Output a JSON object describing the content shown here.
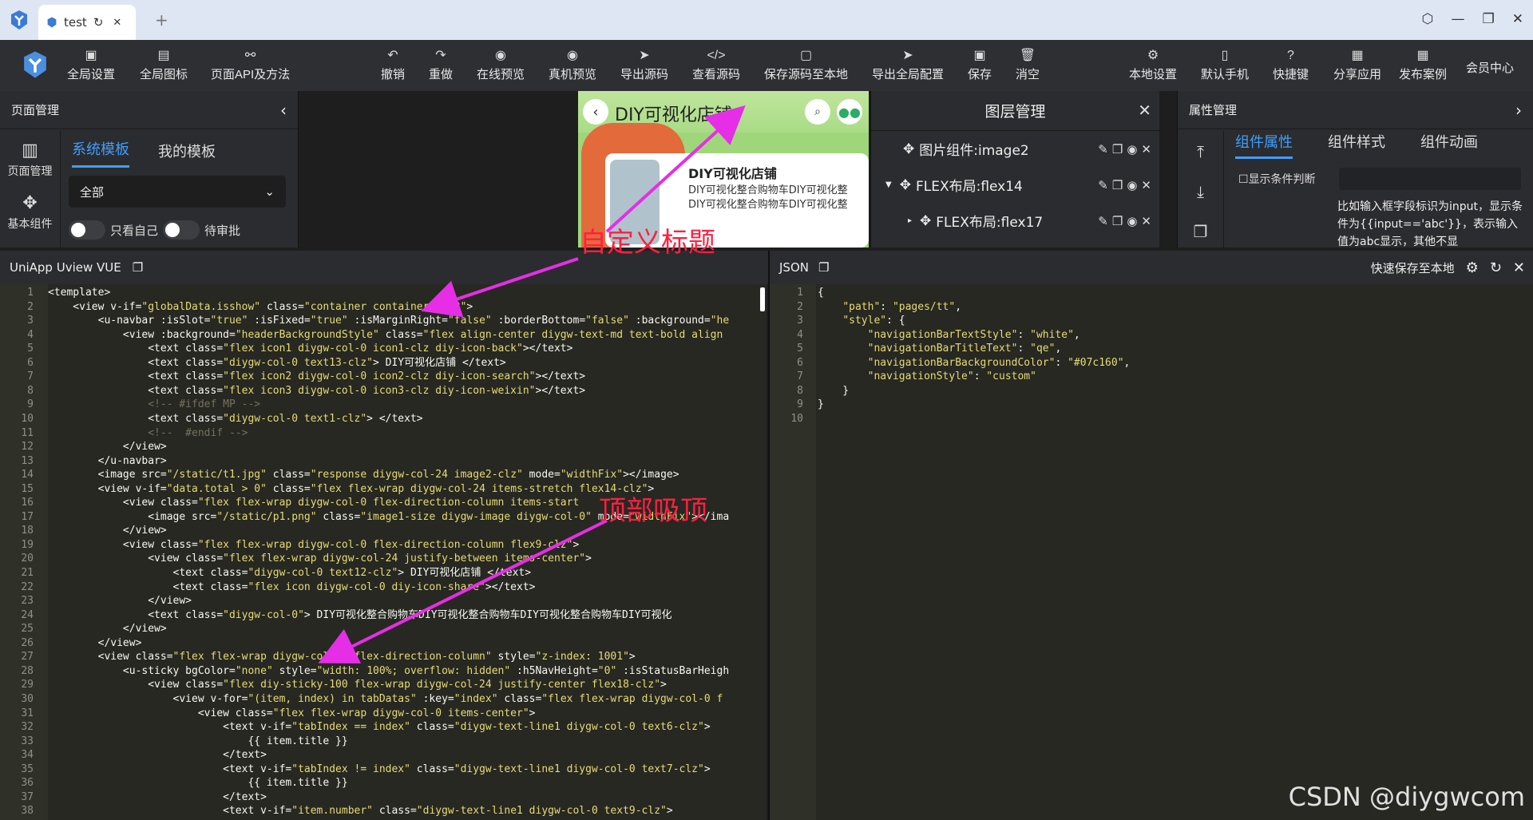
{
  "browser": {
    "tab_title": "test",
    "reload_glyph": "↻",
    "close_glyph": "✕",
    "newtab_glyph": "+"
  },
  "toolbar": {
    "items": [
      {
        "label": "全局设置",
        "icon": "settings-code-icon"
      },
      {
        "label": "全局图标",
        "icon": "image-icon"
      },
      {
        "label": "页面API及方法",
        "icon": "link-icon"
      },
      {
        "label": "撤销",
        "icon": "undo-icon"
      },
      {
        "label": "重做",
        "icon": "redo-icon"
      },
      {
        "label": "在线预览",
        "icon": "eye-icon"
      },
      {
        "label": "真机预览",
        "icon": "eye-icon"
      },
      {
        "label": "导出源码",
        "icon": "send-icon"
      },
      {
        "label": "查看源码",
        "icon": "code-icon"
      },
      {
        "label": "保存源码至本地",
        "icon": "file-icon"
      },
      {
        "label": "导出全局配置",
        "icon": "send-icon"
      },
      {
        "label": "保存",
        "icon": "save-icon"
      },
      {
        "label": "消空",
        "icon": "trash-icon"
      },
      {
        "label": "本地设置",
        "icon": "gear-icon"
      },
      {
        "label": "默认手机",
        "icon": "phone-icon"
      },
      {
        "label": "快捷键",
        "icon": "help-icon"
      },
      {
        "label": "分享应用",
        "icon": "share-icon"
      },
      {
        "label": "发布案例",
        "icon": "publish-icon"
      }
    ],
    "member": "会员中心"
  },
  "left_panel": {
    "title": "页面管理",
    "side": [
      "页面管理",
      "基本组件"
    ],
    "tabs": [
      "系统模板",
      "我的模板"
    ],
    "select_value": "全部",
    "toggle1": "只看自己",
    "toggle2": "待审批"
  },
  "preview": {
    "title": "DIY可视化店铺",
    "card_title": "DIY可视化店铺",
    "card_desc1": "DIY可视化整合购物车DIY可视化整",
    "card_desc2": "DIY可视化整合购物车DIY可视化整"
  },
  "layers": {
    "title": "图层管理",
    "rows": [
      {
        "label": "图片组件:image2"
      },
      {
        "label": "FLEX布局:flex14"
      },
      {
        "label": "FLEX布局:flex17"
      }
    ]
  },
  "props": {
    "title": "属性管理",
    "tabs": [
      "组件属性",
      "组件样式",
      "组件动画"
    ],
    "condition_label": "显示条件判断",
    "hint": "比如输入框字段标识为input，显示条件为{{input=='abc'}}，表示输入值为abc显示，其他不显"
  },
  "editor_left": {
    "title": "UniApp Uview VUE",
    "lines": [
      [
        {
          "t": "<template>"
        }
      ],
      [
        {
          "t": "    <view v-if="
        },
        {
          "s": "\"globalData.isshow\""
        },
        {
          "t": " class="
        },
        {
          "s": "\"container container29152\""
        },
        {
          "t": ">"
        }
      ],
      [
        {
          "t": "        <u-navbar :isSlot="
        },
        {
          "s": "\"true\""
        },
        {
          "t": " :isFixed="
        },
        {
          "s": "\"true\""
        },
        {
          "t": " :isMarginRight="
        },
        {
          "s": "\"false\""
        },
        {
          "t": " :borderBottom="
        },
        {
          "s": "\"false\""
        },
        {
          "t": " :background="
        },
        {
          "s": "\"he"
        }
      ],
      [
        {
          "t": "            <view :background="
        },
        {
          "s": "\"headerBackgroundStyle\""
        },
        {
          "t": " class="
        },
        {
          "s": "\"flex align-center diygw-text-md text-bold align"
        }
      ],
      [
        {
          "t": "                <text class="
        },
        {
          "s": "\"flex icon1 diygw-col-0 icon1-clz diy-icon-back\""
        },
        {
          "t": "></text>"
        }
      ],
      [
        {
          "t": "                <text class="
        },
        {
          "s": "\"diygw-col-0 text13-clz\""
        },
        {
          "t": "> DIY可视化店铺 </text>"
        }
      ],
      [
        {
          "t": "                <text class="
        },
        {
          "s": "\"flex icon2 diygw-col-0 icon2-clz diy-icon-search\""
        },
        {
          "t": "></text>"
        }
      ],
      [
        {
          "t": "                <text class="
        },
        {
          "s": "\"flex icon3 diygw-col-0 icon3-clz diy-icon-weixin\""
        },
        {
          "t": "></text>"
        }
      ],
      [
        {
          "c": "                <!-- #ifdef MP -->"
        }
      ],
      [
        {
          "t": "                <text class="
        },
        {
          "s": "\"diygw-col-0 text1-clz\""
        },
        {
          "t": "> </text>"
        }
      ],
      [
        {
          "c": "                <!--  #endif -->"
        }
      ],
      [
        {
          "t": "            </view>"
        }
      ],
      [
        {
          "t": "        </u-navbar>"
        }
      ],
      [
        {
          "t": "        <image src="
        },
        {
          "s": "\"/static/t1.jpg\""
        },
        {
          "t": " class="
        },
        {
          "s": "\"response diygw-col-24 image2-clz\""
        },
        {
          "t": " mode="
        },
        {
          "s": "\"widthFix\""
        },
        {
          "t": "></image>"
        }
      ],
      [
        {
          "t": "        <view v-if="
        },
        {
          "s": "\"data.total > 0\""
        },
        {
          "t": " class="
        },
        {
          "s": "\"flex flex-wrap diygw-col-24 items-stretch flex14-clz\""
        },
        {
          "t": ">"
        }
      ],
      [
        {
          "t": "            <view class="
        },
        {
          "s": "\"flex flex-wrap diygw-col-0 flex-direction-column items-start"
        }
      ],
      [
        {
          "t": "                <image src="
        },
        {
          "s": "\"/static/p1.png\""
        },
        {
          "t": " class="
        },
        {
          "s": "\"image1-size diygw-image diygw-col-0\""
        },
        {
          "t": " mode="
        },
        {
          "s": "\"widthFix\""
        },
        {
          "t": "></ima"
        }
      ],
      [
        {
          "t": "            </view>"
        }
      ],
      [
        {
          "t": "            <view class="
        },
        {
          "s": "\"flex flex-wrap diygw-col-0 flex-direction-column flex9-clz\""
        },
        {
          "t": ">"
        }
      ],
      [
        {
          "t": "                <view class="
        },
        {
          "s": "\"flex flex-wrap diygw-col-24 justify-between items-center\""
        },
        {
          "t": ">"
        }
      ],
      [
        {
          "t": "                    <text class="
        },
        {
          "s": "\"diygw-col-0 text12-clz\""
        },
        {
          "t": "> DIY可视化店铺 </text>"
        }
      ],
      [
        {
          "t": "                    <text class="
        },
        {
          "s": "\"flex icon diygw-col-0 diy-icon-share\""
        },
        {
          "t": "></text>"
        }
      ],
      [
        {
          "t": "                </view>"
        }
      ],
      [
        {
          "t": "                <text class="
        },
        {
          "s": "\"diygw-col-0\""
        },
        {
          "t": "> DIY可视化整合购物车DIY可视化整合购物车DIY可视化整合购物车DIY可视化"
        }
      ],
      [
        {
          "t": "            </view>"
        }
      ],
      [
        {
          "t": "        </view>"
        }
      ],
      [
        {
          "t": "        <view class="
        },
        {
          "s": "\"flex flex-wrap diygw-col-24 flex-direction-column\""
        },
        {
          "t": " style="
        },
        {
          "s": "\"z-index: 1001\""
        },
        {
          "t": ">"
        }
      ],
      [
        {
          "t": "            <u-sticky bgColor="
        },
        {
          "s": "\"none\""
        },
        {
          "t": " style="
        },
        {
          "s": "\"width: 100%; overflow: hidden\""
        },
        {
          "t": " :h5NavHeight="
        },
        {
          "s": "\"0\""
        },
        {
          "t": " :isStatusBarHeigh"
        }
      ],
      [
        {
          "t": "                <view class="
        },
        {
          "s": "\"flex diy-sticky-100 flex-wrap diygw-col-24 justify-center flex18-clz\""
        },
        {
          "t": ">"
        }
      ],
      [
        {
          "t": "                    <view v-for="
        },
        {
          "s": "\"(item, index) in tabDatas\""
        },
        {
          "t": " :key="
        },
        {
          "s": "\"index\""
        },
        {
          "t": " class="
        },
        {
          "s": "\"flex flex-wrap diygw-col-0 f"
        }
      ],
      [
        {
          "t": "                        <view class="
        },
        {
          "s": "\"flex flex-wrap diygw-col-0 items-center\""
        },
        {
          "t": ">"
        }
      ],
      [
        {
          "t": "                            <text v-if="
        },
        {
          "s": "\"tabIndex == index\""
        },
        {
          "t": " class="
        },
        {
          "s": "\"diygw-text-line1 diygw-col-0 text6-clz\""
        },
        {
          "t": ">"
        }
      ],
      [
        {
          "t": "                                {{ item.title }}"
        }
      ],
      [
        {
          "t": "                            </text>"
        }
      ],
      [
        {
          "t": "                            <text v-if="
        },
        {
          "s": "\"tabIndex != index\""
        },
        {
          "t": " class="
        },
        {
          "s": "\"diygw-text-line1 diygw-col-0 text7-clz\""
        },
        {
          "t": ">"
        }
      ],
      [
        {
          "t": "                                {{ item.title }}"
        }
      ],
      [
        {
          "t": "                            </text>"
        }
      ],
      [
        {
          "t": "                            <text v-if="
        },
        {
          "s": "\"item.number\""
        },
        {
          "t": " class="
        },
        {
          "s": "\"diygw-text-line1 diygw-col-0 text9-clz\""
        },
        {
          "t": ">"
        }
      ]
    ]
  },
  "editor_right": {
    "title": "JSON",
    "save_label": "快速保存至本地",
    "lines": [
      [
        {
          "t": "{"
        }
      ],
      [
        {
          "t": "    "
        },
        {
          "s": "\"path\""
        },
        {
          "t": ": "
        },
        {
          "s": "\"pages/tt\""
        },
        {
          "t": ","
        }
      ],
      [
        {
          "t": "    "
        },
        {
          "s": "\"style\""
        },
        {
          "t": ": {"
        }
      ],
      [
        {
          "t": "        "
        },
        {
          "s": "\"navigationBarTextStyle\""
        },
        {
          "t": ": "
        },
        {
          "s": "\"white\""
        },
        {
          "t": ","
        }
      ],
      [
        {
          "t": "        "
        },
        {
          "s": "\"navigationBarTitleText\""
        },
        {
          "t": ": "
        },
        {
          "s": "\"qe\""
        },
        {
          "t": ","
        }
      ],
      [
        {
          "t": "        "
        },
        {
          "s": "\"navigationBarBackgroundColor\""
        },
        {
          "t": ": "
        },
        {
          "s": "\"#07c160\""
        },
        {
          "t": ","
        }
      ],
      [
        {
          "t": "        "
        },
        {
          "s": "\"navigationStyle\""
        },
        {
          "t": ": "
        },
        {
          "s": "\"custom\""
        }
      ],
      [
        {
          "t": "    }"
        }
      ],
      [
        {
          "t": "}"
        }
      ],
      [
        {
          "t": ""
        }
      ]
    ]
  },
  "annotations": {
    "custom_title": "自定义标题",
    "sticky_top": "顶部吸顶"
  },
  "watermark": "CSDN @diygwcom",
  "colors": {
    "accent": "#409eff",
    "annotation": "#ff2040",
    "arrow": "#e62ee6"
  }
}
